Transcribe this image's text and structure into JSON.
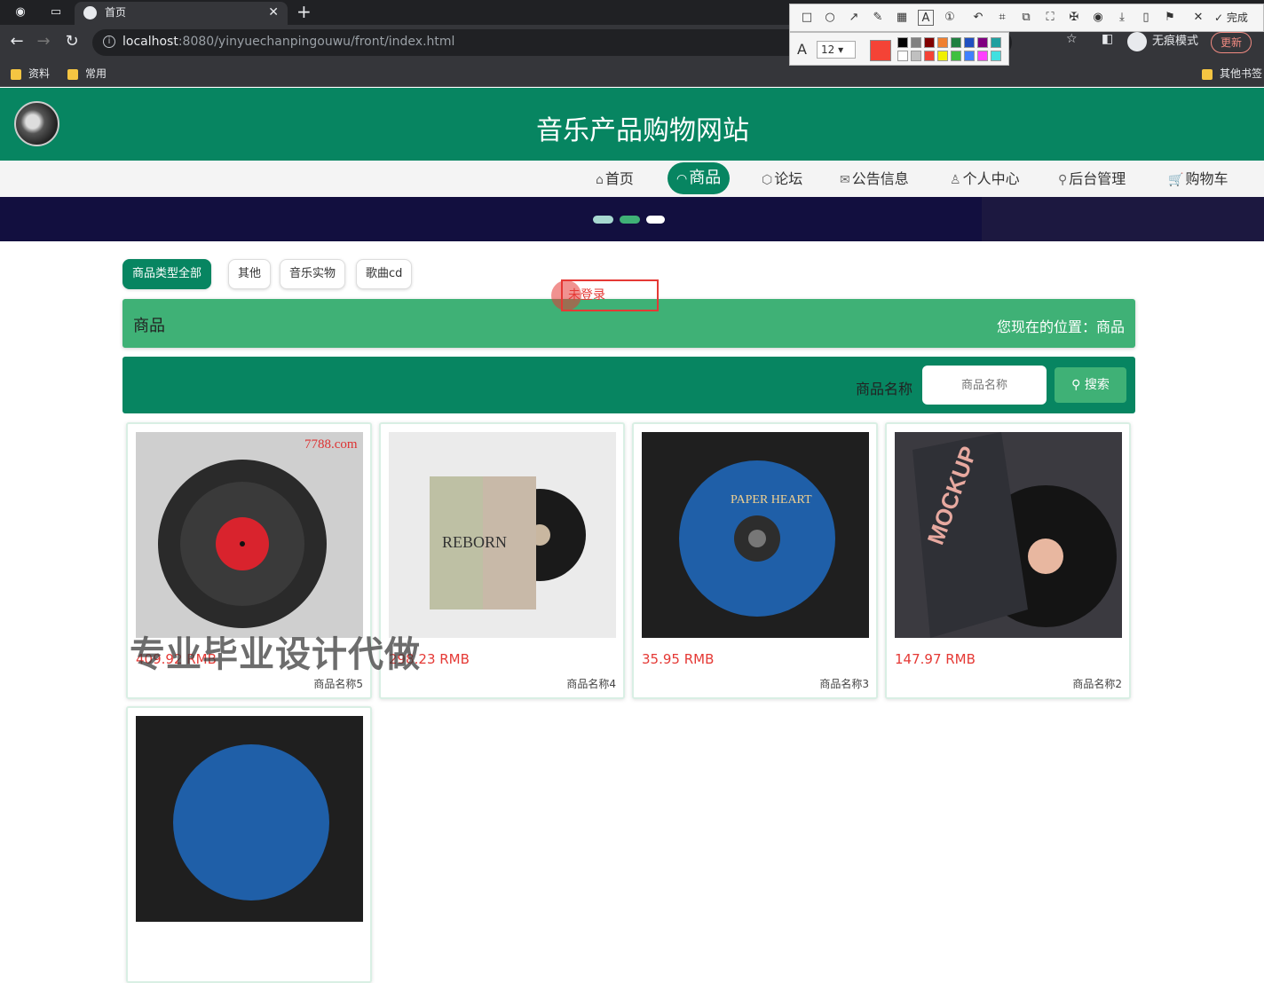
{
  "browser": {
    "tab_title": "首页",
    "url_host": "localhost",
    "url_rest": ":8080/yinyuechanpingouwu/front/index.html",
    "incognito_label": "无痕模式",
    "update_label": "更新",
    "bookmarks": [
      "资料",
      "常用"
    ],
    "other_bookmarks": "其他书签"
  },
  "snap_tool": {
    "done_label": "完成",
    "font_size": "12",
    "current_color": "#f44336",
    "palette": [
      "#000000",
      "#808080",
      "#800000",
      "#f08030",
      "#208040",
      "#2050c0",
      "#800080",
      "#20a0a0",
      "#ffffff",
      "#c0c0c0",
      "#f44336",
      "#f0f000",
      "#40c040",
      "#4080ff",
      "#ff40ff",
      "#40e0e0"
    ]
  },
  "site": {
    "title": "音乐产品购物网站"
  },
  "nav": [
    {
      "label": "首页",
      "icon": "⌂"
    },
    {
      "label": "商品",
      "icon": "◠"
    },
    {
      "label": "论坛",
      "icon": "⬡"
    },
    {
      "label": "公告信息",
      "icon": "✉"
    },
    {
      "label": "个人中心",
      "icon": "♙"
    },
    {
      "label": "后台管理",
      "icon": "⚲"
    },
    {
      "label": "购物车",
      "icon": "🛒"
    }
  ],
  "categories": [
    "商品类型全部",
    "其他",
    "音乐实物",
    "歌曲cd"
  ],
  "breadcrumb": {
    "title": "商品",
    "location": "您现在的位置：商品"
  },
  "search": {
    "label": "商品名称",
    "placeholder": "商品名称",
    "button": "搜索"
  },
  "products": [
    {
      "price": "409.92 RMB",
      "name": "商品名称5",
      "img_text": "7788.com"
    },
    {
      "price": "298.23 RMB",
      "name": "商品名称4",
      "img_text": "REBORN"
    },
    {
      "price": "35.95 RMB",
      "name": "商品名称3",
      "img_text": "PAPER HEART"
    },
    {
      "price": "147.97 RMB",
      "name": "商品名称2",
      "img_text": "MOCKUP"
    }
  ],
  "annotation": {
    "text": "未登录"
  },
  "watermark": "专业毕业设计代做"
}
